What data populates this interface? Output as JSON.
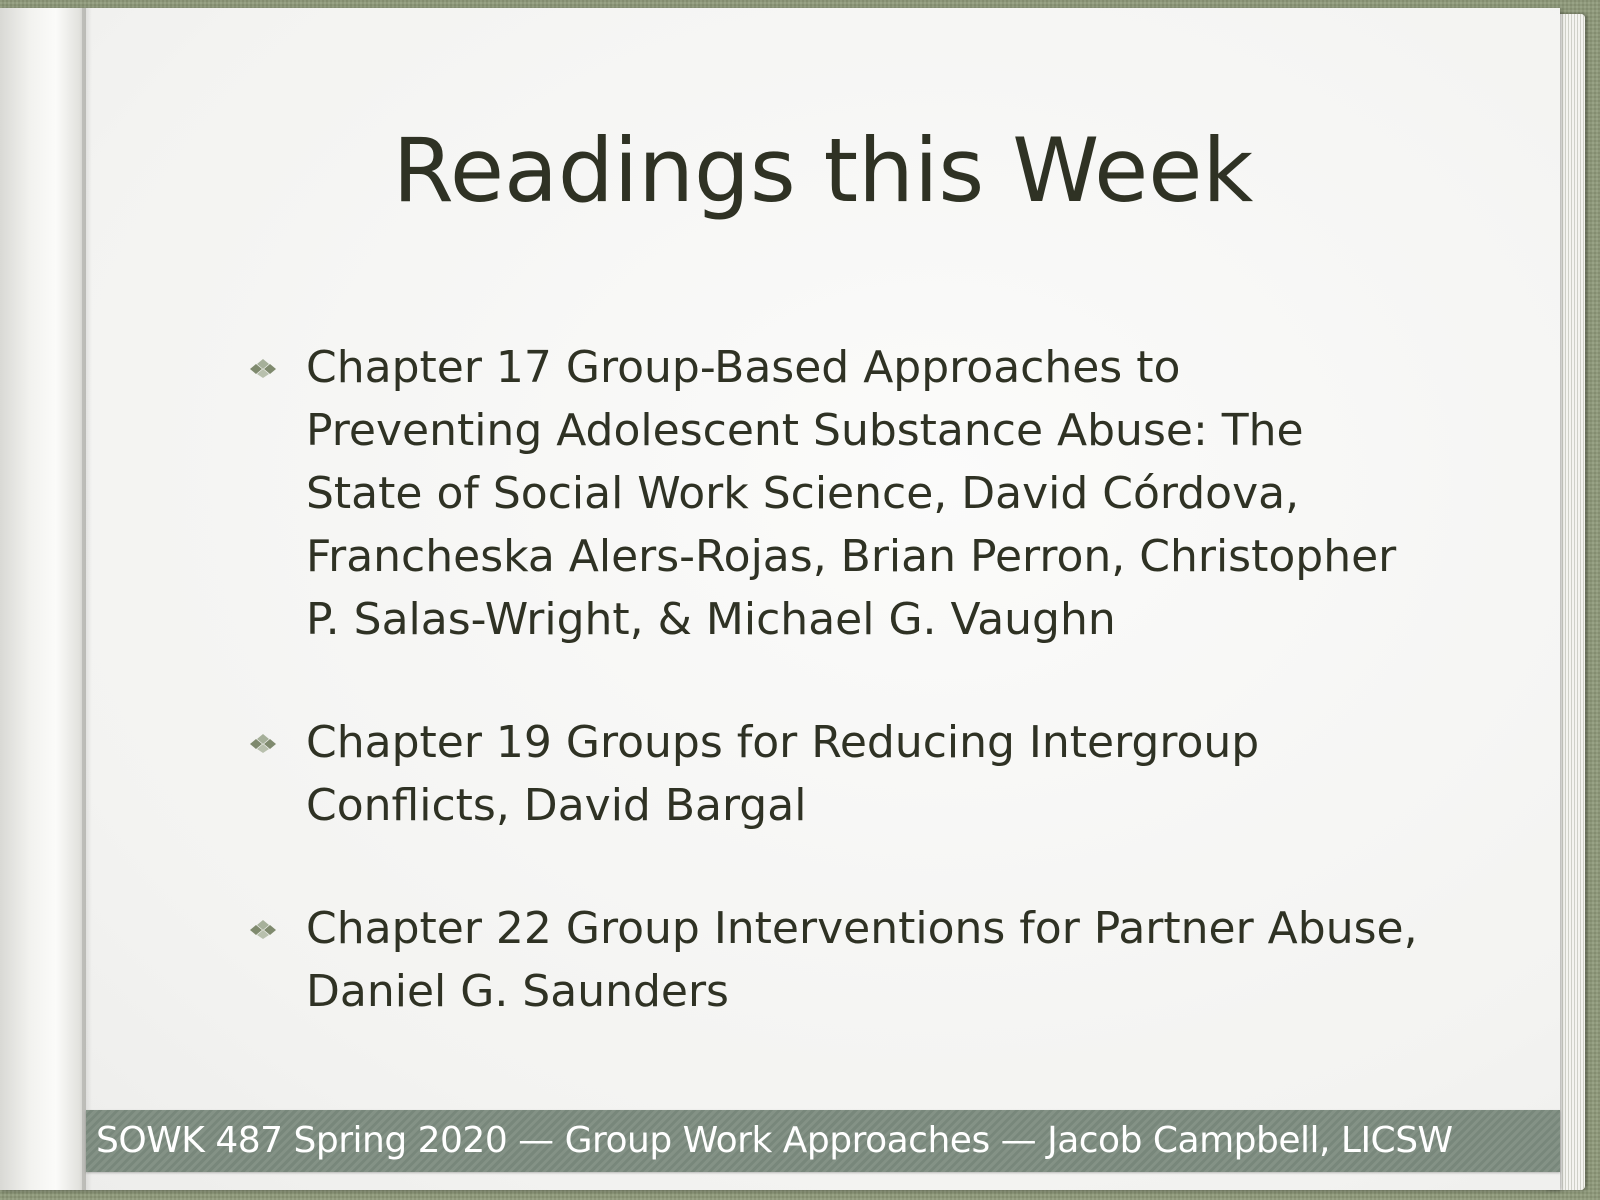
{
  "slide": {
    "title": "Readings this Week",
    "readings": [
      {
        "text": "Chapter 17 Group-Based Approaches to Preventing Adolescent Substance Abuse: The State of Social Work Science, David Córdova, Francheska Alers-Rojas, Brian Perron, Christopher P. Salas-Wright, & Michael G. Vaughn"
      },
      {
        "text": "Chapter 19 Groups for Reducing Intergroup Conflicts, David Bargal"
      },
      {
        "text": "Chapter 22 Group Interventions for Partner Abuse, Daniel G. Saunders"
      }
    ],
    "footer": "SOWK 487 Spring 2020 — Group Work Approaches — Jacob Campbell, LICSW",
    "bullet_icon": "diamond-cluster-icon"
  },
  "colors": {
    "text": "#2f3224",
    "accent": "#8e9979",
    "footer_bg": "#7d8c80",
    "footer_text": "#ffffff",
    "page": "#f6f6f4"
  }
}
